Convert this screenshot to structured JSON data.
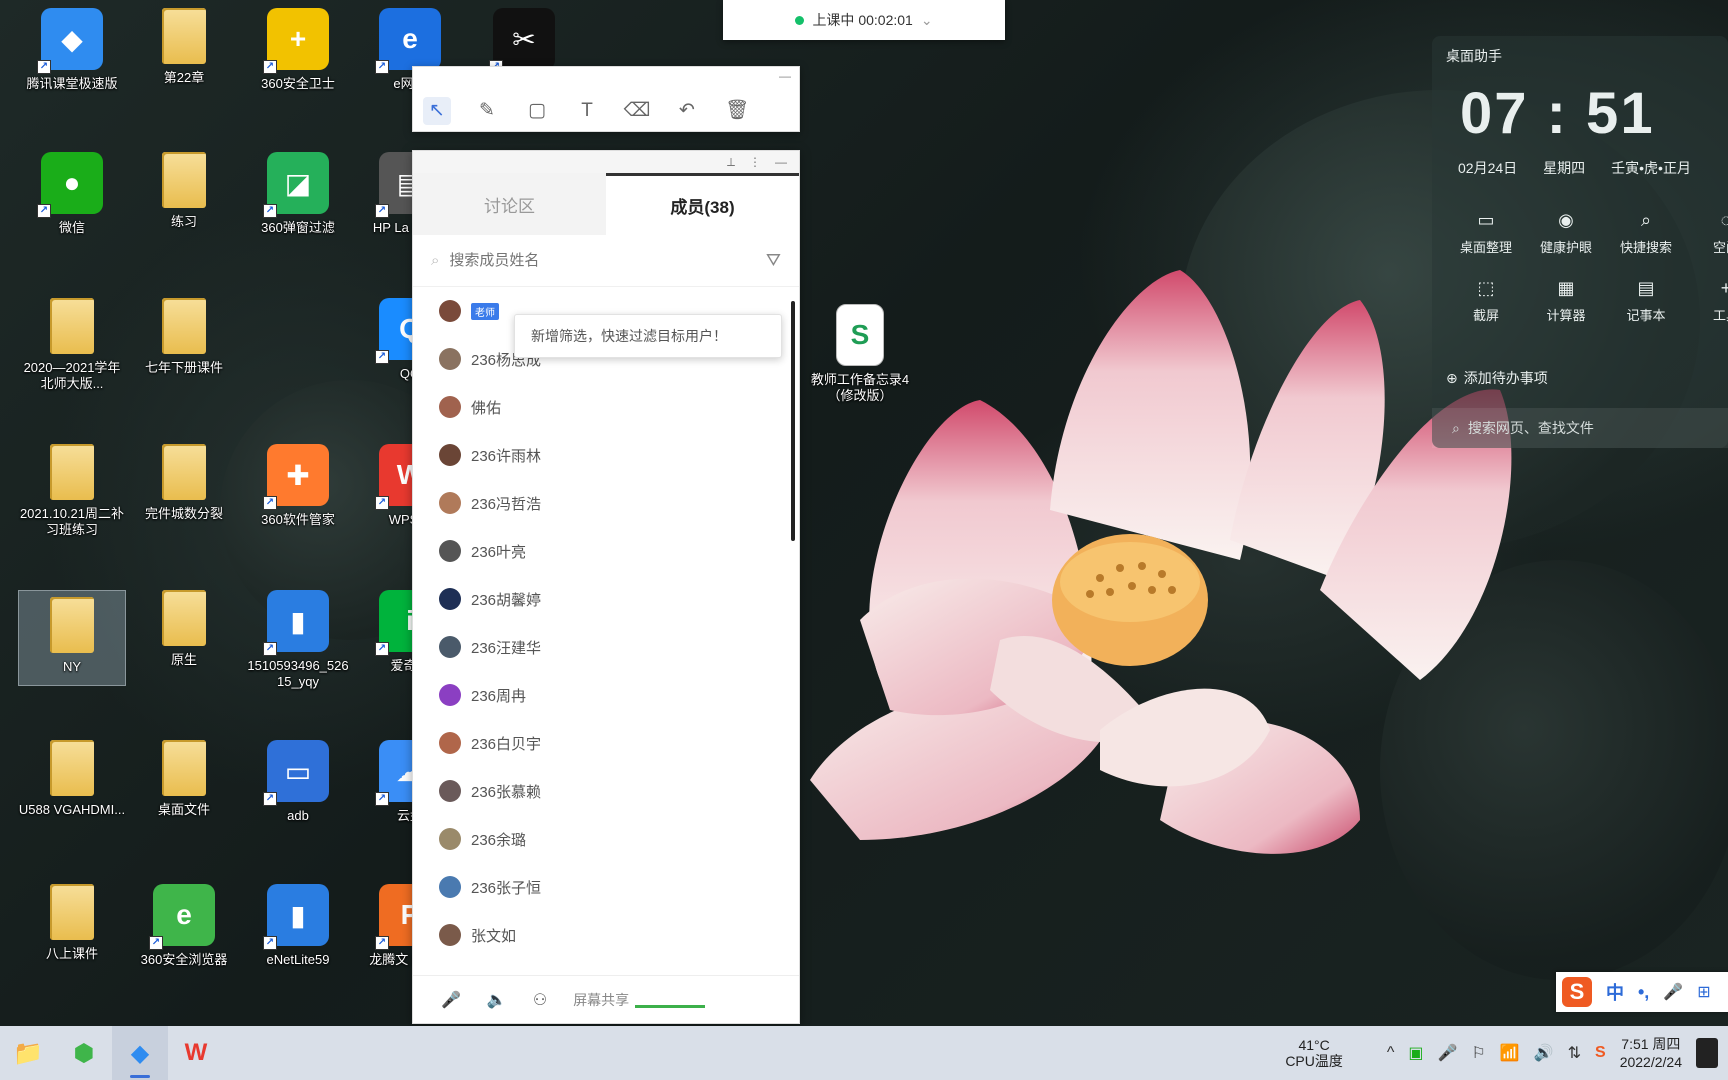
{
  "meeting_bar": {
    "status": "上课中 00:02:01",
    "chevron": "⌄"
  },
  "annotation_toolbar": {
    "minimize": "—",
    "tools": [
      {
        "icon": "↖",
        "name": "select-tool"
      },
      {
        "icon": "✎",
        "name": "pen-tool"
      },
      {
        "icon": "▢",
        "name": "shape-tool"
      },
      {
        "icon": "T",
        "name": "text-tool"
      },
      {
        "icon": "⌫",
        "name": "eraser-tool"
      },
      {
        "icon": "↶",
        "name": "undo-tool"
      },
      {
        "icon": "🗑",
        "name": "clear-tool"
      }
    ]
  },
  "panel": {
    "titlebar": {
      "pin": "⟂",
      "more": "⋮",
      "minimize": "—"
    },
    "tabs": [
      "讨论区",
      "成员(38)"
    ],
    "search_placeholder": "搜索成员姓名",
    "filter_icon": "⛛",
    "tooltip": "新增筛选，快速过滤目标用户！",
    "first_member_tag": "老师",
    "members": [
      "",
      "236杨思成",
      "佛佑",
      "236许雨林",
      "236冯哲浩",
      "236叶亮",
      "236胡馨婷",
      "236汪建华",
      "236周冉",
      "236白贝宇",
      "236张慕赖",
      "236余璐",
      "236张子恒",
      "张文如"
    ],
    "bottom": {
      "mic": "🎤",
      "speaker": "🔈",
      "member": "⚇",
      "share": "屏幕共享"
    }
  },
  "desktop_icons": [
    {
      "label": "腾讯课堂极速版",
      "kind": "app",
      "color": "#2f8cf0",
      "glyph": "◆"
    },
    {
      "label": "第22章",
      "kind": "folder"
    },
    {
      "label": "360安全卫士",
      "kind": "app",
      "color": "#f2c200",
      "glyph": "+"
    },
    {
      "label": "e网通",
      "kind": "app",
      "color": "#1c6fe0",
      "glyph": "e"
    },
    {
      "label": "",
      "kind": "app",
      "color": "#111",
      "glyph": "✂"
    },
    {
      "label": "微信",
      "kind": "app",
      "color": "#1aad19",
      "glyph": "●"
    },
    {
      "label": "练习",
      "kind": "folder"
    },
    {
      "label": "360弹窗过滤",
      "kind": "app",
      "color": "#25b05a",
      "glyph": "◪"
    },
    {
      "label": "HP La Pro M",
      "kind": "app",
      "color": "#555",
      "glyph": "▤"
    },
    {
      "label": "2020—2021学年北师大版...",
      "kind": "folder"
    },
    {
      "label": "七年下册课件",
      "kind": "folder"
    },
    {
      "label": "QQ",
      "kind": "app",
      "color": "#1a8cff",
      "glyph": "Q"
    },
    {
      "label": "2021.10.21周二补习班练习",
      "kind": "folder"
    },
    {
      "label": "完件城数分裂",
      "kind": "folder"
    },
    {
      "label": "360软件管家",
      "kind": "app",
      "color": "#ff7a2e",
      "glyph": "✚"
    },
    {
      "label": "WPS C",
      "kind": "app",
      "color": "#e8392f",
      "glyph": "W"
    },
    {
      "label": "NY",
      "kind": "folder",
      "selected": true
    },
    {
      "label": "原生",
      "kind": "folder"
    },
    {
      "label": "1510593496_52615_yqy",
      "kind": "app",
      "color": "#2a7de1",
      "glyph": "▮"
    },
    {
      "label": "爱奇艺",
      "kind": "app",
      "color": "#00b33c",
      "glyph": "i"
    },
    {
      "label": "U588 VGAHDMI...",
      "kind": "folder"
    },
    {
      "label": "桌面文件",
      "kind": "folder"
    },
    {
      "label": "adb",
      "kind": "app",
      "color": "#2f70d8",
      "glyph": "▭"
    },
    {
      "label": "云盘",
      "kind": "app",
      "color": "#3a8ef6",
      "glyph": "☁"
    },
    {
      "label": "八上课件",
      "kind": "folder"
    },
    {
      "label": "360安全浏览器",
      "kind": "app",
      "color": "#3fb54a",
      "glyph": "e"
    },
    {
      "label": "eNetLite59",
      "kind": "app",
      "color": "#2a7de1",
      "glyph": "▮"
    },
    {
      "label": "龙腾文 线下课",
      "kind": "app",
      "color": "#ef6c22",
      "glyph": "P"
    },
    {
      "label": "教师工作备忘录4（修改版）",
      "kind": "sheet"
    }
  ],
  "widget": {
    "title": "桌面助手",
    "time": "07 : 51",
    "date": "02月24日",
    "weekday": "星期四",
    "lunar": "壬寅•虎•正月",
    "tools": [
      {
        "icon": "▭",
        "label": "桌面整理"
      },
      {
        "icon": "◉",
        "label": "健康护眼"
      },
      {
        "icon": "⌕",
        "label": "快捷搜索"
      },
      {
        "icon": "◌",
        "label": "空间"
      },
      {
        "icon": "⬚",
        "label": "截屏"
      },
      {
        "icon": "▦",
        "label": "计算器"
      },
      {
        "icon": "▤",
        "label": "记事本"
      },
      {
        "icon": "+",
        "label": "工具"
      }
    ],
    "todo": "添加待办事项",
    "search": "搜索网页、查找文件"
  },
  "ime": {
    "logo": "S",
    "mode": "中",
    "punct": "•,",
    "mic": "🎤",
    "more": "⊞"
  },
  "taskbar": {
    "apps": [
      {
        "icon": "📁",
        "name": "file-explorer"
      },
      {
        "icon": "⬢",
        "name": "360-app"
      },
      {
        "icon": "◆",
        "name": "tencent-classroom",
        "active": true
      },
      {
        "icon": "W",
        "name": "wps-office"
      }
    ],
    "cpu_temp": "41°C",
    "cpu_label": "CPU温度",
    "tray_icons": [
      "^",
      "▣",
      "🎤",
      "⚐",
      "📶",
      "🔊",
      "⇅",
      "S"
    ],
    "clock_time": "7:51 周四",
    "clock_date": "2022/2/24"
  }
}
